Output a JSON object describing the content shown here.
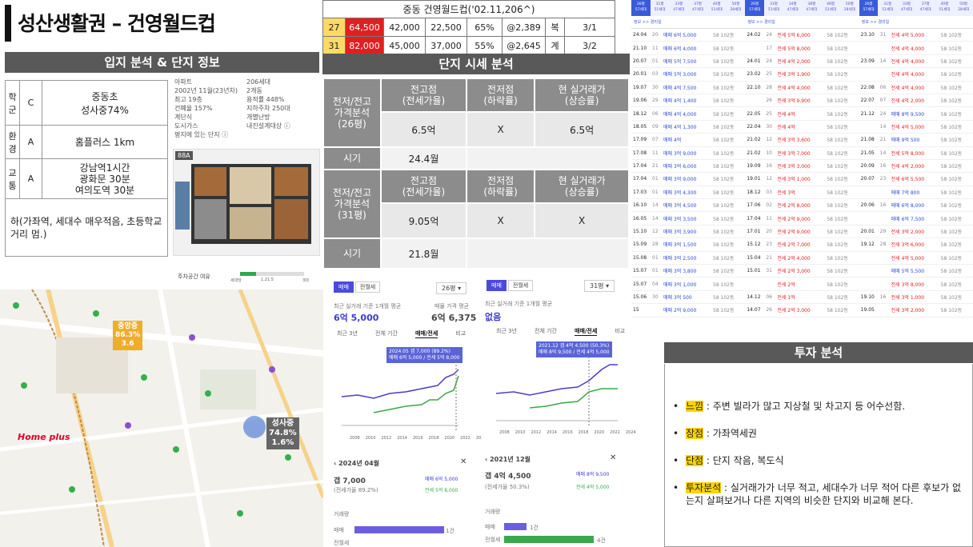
{
  "title": "성산생활권 – 건영월드컵",
  "location": {
    "header": "입지 분석 & 단지 정보",
    "rows": [
      {
        "k": "학\n군",
        "g": "C",
        "v": "중동초\n성사중74%"
      },
      {
        "k": "환\n경",
        "g": "A",
        "v": "홈플러스 1km"
      },
      {
        "k": "교\n통",
        "g": "A",
        "v": "강남역1시간\n광화문 30분\n여의도역 30분"
      }
    ],
    "note": "하(가좌역, 세대수 매우적음, 초등학교 거리 멈.)"
  },
  "apt_info": {
    "left": [
      "아파트",
      "2002년 11월(23년차)",
      "최고 19층",
      "건폐율 157%",
      "계단식",
      "도시가스",
      "평지에 있는 단지 ⓘ"
    ],
    "right": [
      "206세대",
      "2개동",
      "용적률 448%",
      "지하주차 250대",
      "개별난방",
      "내진설계대상 ⓘ"
    ],
    "plan_label": "88A",
    "parking": "주차공간 여유",
    "parking_sub": [
      "세대당",
      "1.21.5",
      "3대"
    ],
    "parking_level": 0.25
  },
  "top_table": {
    "title": "중동 건영월드컵('02.11,206^)",
    "rows": [
      [
        "27",
        "64,500",
        "42,000",
        "22,500",
        "65%",
        "@2,389",
        "복",
        "3/1"
      ],
      [
        "31",
        "82,000",
        "45,000",
        "37,000",
        "55%",
        "@2,645",
        "계",
        "3/2"
      ]
    ]
  },
  "price": {
    "header": "단지 시세 분석",
    "blocks": [
      {
        "label": "전저/전고\n가격분석\n(26평)",
        "cols": [
          "전고점\n(전세가율)",
          "전저점\n(하락률)",
          "현 실거래가\n(상승률)"
        ],
        "vals": [
          "6.5억",
          "X",
          "6.5억"
        ],
        "time_label": "시기",
        "time": "24.4월"
      },
      {
        "label": "전저/전고\n가격분석\n(31평)",
        "cols": [
          "전고점\n(전세가율)",
          "전저점\n(하락률)",
          "현 실거래가\n(상승률)"
        ],
        "vals": [
          "9.05억",
          "X",
          "X"
        ],
        "time_label": "시기",
        "time": "21.8월"
      }
    ]
  },
  "map": {
    "badge1": [
      "중앙중",
      "86.3%",
      "3.6"
    ],
    "badge2": [
      "성사중",
      "74.8%",
      "1.6%"
    ],
    "homeplus": "Home plus"
  },
  "charts": [
    {
      "tabs": [
        "매매",
        "전월세"
      ],
      "size": "26평 ▾",
      "sub1": "최근 실거래 기준 1개월 평균",
      "v1": "6억 5,000",
      "sub2": "매물 가격 평균",
      "v2": "6억 6,375",
      "ranges": [
        "최근 3년",
        "전체 기간",
        "매매/전세",
        "비교"
      ],
      "tip": [
        "2024.05  갭 7,000 (89.2%)",
        "매매 6억 5,000 / 전세 5억 8,000"
      ],
      "years": [
        "2008",
        "2010",
        "2012",
        "2014",
        "2016",
        "2018",
        "2020",
        "2022",
        "2024"
      ],
      "date": "2024년 04월",
      "gap": "갭 7,000",
      "gap_sub": "(전세가율 89.2%)",
      "l1": "매매 6억 5,000",
      "l2": "전세 5억 8,000",
      "vol_label": "거래량",
      "vol": [
        {
          "name": "매매",
          "n": "1건"
        },
        {
          "name": "전월세",
          "n": ""
        }
      ]
    },
    {
      "tabs": [
        "매매",
        "전월세"
      ],
      "size": "31평 ▾",
      "sub1": "최근 실거래 기준 1개월 평균",
      "v1": "없음",
      "ranges": [
        "최근 3년",
        "전체 기간",
        "매매/전세",
        "비교"
      ],
      "tip": [
        "2021.12  갭 4억 4,500 (50.3%)",
        "매매 8억 9,500 / 전세 4억 5,000"
      ],
      "years": [
        "2008",
        "2010",
        "2012",
        "2014",
        "2016",
        "2018",
        "2020",
        "2022",
        "2024"
      ],
      "date": "2021년 12월",
      "gap": "갭 4억 4,500",
      "gap_sub": "(전세가율 50.3%)",
      "l1": "매매 8억 9,500",
      "l2": "전세 4억 5,000",
      "vol_label": "거래량",
      "vol": [
        {
          "name": "매매",
          "n": "1건"
        },
        {
          "name": "전월세",
          "n": "4건"
        }
      ]
    }
  ],
  "tx": {
    "left": [
      [
        "24.04",
        "20",
        "매매 6억 5,000"
      ],
      [
        "21.10",
        "11",
        "매매 6억 4,000"
      ],
      [
        "20.07",
        "01",
        "매매 5억 7,500"
      ],
      [
        "20.01",
        "03",
        "매매 5억 3,000"
      ],
      [
        "19.07",
        "30",
        "매매 4억 7,500"
      ],
      [
        "19.06",
        "29",
        "매매 4억 1,400"
      ],
      [
        "18.12",
        "06",
        "매매 4억 4,000"
      ],
      [
        "18.05",
        "09",
        "매매 4억 1,300"
      ],
      [
        "17.09",
        "07",
        "매매 4억"
      ],
      [
        "17.08",
        "11",
        "매매 3억 9,000"
      ],
      [
        "17.04",
        "21",
        "매매 3억 6,000"
      ],
      [
        "17.04",
        "01",
        "매매 3억 9,000"
      ],
      [
        "17.03",
        "01",
        "매매 3억 4,300"
      ],
      [
        "16.10",
        "14",
        "매매 3억 4,500"
      ],
      [
        "16.05",
        "14",
        "매매 3억 3,500"
      ],
      [
        "15.10",
        "12",
        "매매 3억 3,900"
      ],
      [
        "15.09",
        "28",
        "매매 3억 1,500"
      ],
      [
        "15.08",
        "01",
        "매매 3억 2,500"
      ],
      [
        "15.07",
        "01",
        "매매 3억 3,800"
      ],
      [
        "15.07",
        "04",
        "매매 3억 1,000"
      ],
      [
        "15.06",
        "30",
        "매매 3억 500"
      ],
      [
        "15",
        "",
        "매매 2억 9,000"
      ]
    ],
    "mid": [
      [
        "24.02",
        "24",
        "전세 5억 6,000"
      ],
      [
        "",
        "17",
        "전세 5억 8,000"
      ],
      [
        "24.01",
        "24",
        "전세 4억 2,000"
      ],
      [
        "23.02",
        "25",
        "전세 3억 1,900"
      ],
      [
        "22.10",
        "28",
        "전세 4억 4,000"
      ],
      [
        "",
        "26",
        "전세 3억 9,900"
      ],
      [
        "22.05",
        "25",
        "전세 4억"
      ],
      [
        "22.04",
        "30",
        "전세 4억"
      ],
      [
        "21.02",
        "12",
        "전세 3억 3,600"
      ],
      [
        "21.02",
        "10",
        "전세 3억 7,000"
      ],
      [
        "19.09",
        "16",
        "전세 3억 3,000"
      ],
      [
        "19.01",
        "12",
        "전세 3억 1,000"
      ],
      [
        "18.12",
        "03",
        "전세 3억"
      ],
      [
        "17.06",
        "02",
        "전세 2억 8,000"
      ],
      [
        "17.04",
        "11",
        "전세 2억 9,000"
      ],
      [
        "17.01",
        "20",
        "전세 2억 9,000"
      ],
      [
        "15.12",
        "23",
        "전세 2억 7,000"
      ],
      [
        "15.04",
        "21",
        "전세 2억 4,000"
      ],
      [
        "15.01",
        "31",
        "전세 2억 3,000"
      ],
      [
        "",
        "",
        "전세 2억"
      ],
      [
        "14.12",
        "06",
        "전세 1억"
      ],
      [
        "14.07",
        "26",
        "전세 2억 3,000"
      ]
    ],
    "right": [
      [
        "23.10",
        "31",
        "전세 4억 5,000"
      ],
      [
        "",
        "",
        "전세 4억 4,000"
      ],
      [
        "23.09",
        "14",
        "전세 4억 4,000"
      ],
      [
        "",
        "",
        "전세 4억 4,000"
      ],
      [
        "22.08",
        "06",
        "전세 4억 4,000"
      ],
      [
        "22.07",
        "07",
        "전세 4억 2,000"
      ],
      [
        "21.12",
        "24",
        "매매 8억 9,500"
      ],
      [
        "",
        "14",
        "전세 4억 5,000"
      ],
      [
        "21.08",
        "21",
        "매매 9억 500"
      ],
      [
        "21.05",
        "14",
        "전세 5억 8,000"
      ],
      [
        "20.09",
        "16",
        "전세 4억 2,000"
      ],
      [
        "20.07",
        "23",
        "전세 6억 5,500"
      ],
      [
        "",
        "",
        "매매 7억 800"
      ],
      [
        "20.06",
        "16",
        "매매 6억 8,000"
      ],
      [
        "",
        "",
        "매매 6억 7,500"
      ],
      [
        "20.01",
        "29",
        "전세 3억 2,000"
      ],
      [
        "19.12",
        "28",
        "전세 3억 6,000"
      ],
      [
        "",
        "",
        "전세 4억 5,000"
      ],
      [
        "",
        "",
        "매매 5억 5,500"
      ],
      [
        "",
        "",
        "전세 3억 8,000"
      ],
      [
        "19.10",
        "16",
        "전세 3억 1,000"
      ],
      [
        "19.05",
        "",
        "전세 3억 2,000"
      ]
    ],
    "tabs_left": [
      "26평\n57세대",
      "31평\n51세대",
      "33평\n47세대",
      "37평\n47세대",
      "40평\n51세대",
      "50평\n28세대"
    ],
    "tabs_mid": [
      "26평\n57세대",
      "31평\n51세대",
      "34평\n47세대",
      "38평\n47세대",
      "46평\n51세대",
      "50평\n28세대"
    ],
    "tabs_right": [
      "26평\n57세대",
      "31평\n51세대",
      "33평\n47세대",
      "37평\n47세대",
      "40평\n51세대",
      "50평\n28세대"
    ],
    "btn1": "평형",
    "btn2": "평형트",
    "info": "정보 >> 경리일"
  },
  "invest": {
    "header": "투자 분석",
    "items": [
      {
        "k": "느낌",
        "v": " : 주변 빌라가 많고 지상철 및 차고지 등 어수선함."
      },
      {
        "k": "장점",
        "v": " : 가좌역세권"
      },
      {
        "k": "단점",
        "v": " : 단지 작음, 복도식"
      },
      {
        "k": "투자분석",
        "v": " : 실거래가가 너무 적고, 세대수가 너무 적어 다른 후보가 없는지 살펴보거나 다른 지역의 비슷한 단지와 비교해 본다."
      }
    ]
  }
}
